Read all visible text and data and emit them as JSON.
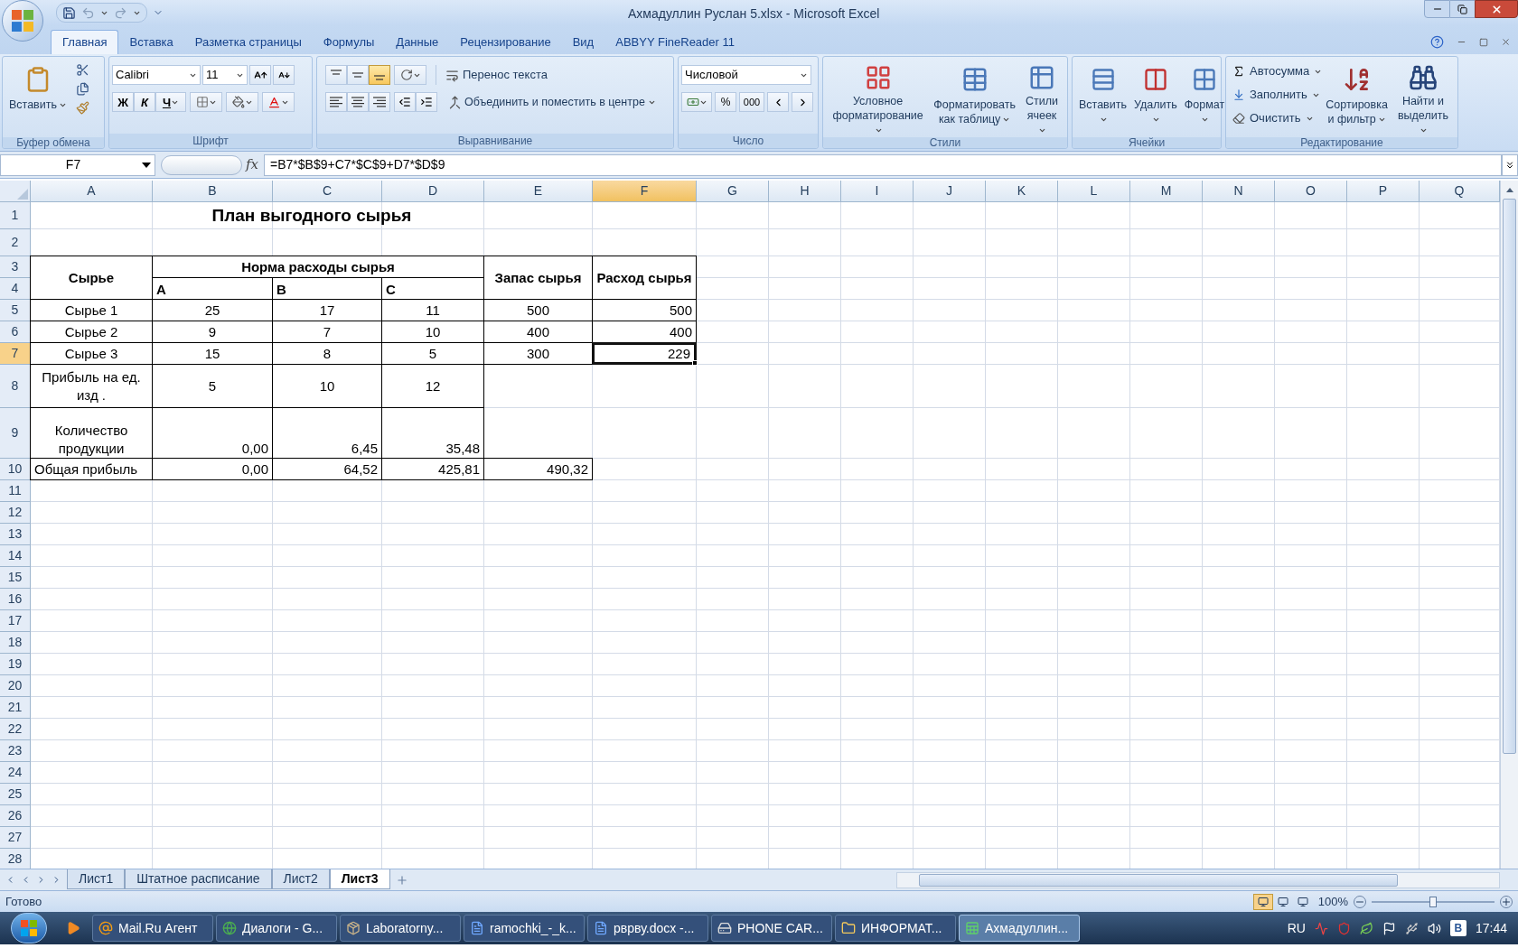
{
  "window": {
    "title": "Ахмадуллин Руслан 5.xlsx - Microsoft Excel"
  },
  "ribbon_tabs": [
    {
      "label": "Главная",
      "selected": true
    },
    {
      "label": "Вставка",
      "selected": false
    },
    {
      "label": "Разметка страницы",
      "selected": false
    },
    {
      "label": "Формулы",
      "selected": false
    },
    {
      "label": "Данные",
      "selected": false
    },
    {
      "label": "Рецензирование",
      "selected": false
    },
    {
      "label": "Вид",
      "selected": false
    },
    {
      "label": "ABBYY FineReader 11",
      "selected": false
    }
  ],
  "ribbon": {
    "clipboard": {
      "paste": "Вставить",
      "label": "Буфер обмена"
    },
    "font": {
      "name": "Calibri",
      "size": "11",
      "bold": "Ж",
      "italic": "К",
      "underline": "Ч",
      "label": "Шрифт"
    },
    "alignment": {
      "vertical": [
        {
          "selected": false
        },
        {
          "selected": false
        },
        {
          "selected": true
        }
      ],
      "wrap": "Перенос текста",
      "merge": "Объединить и поместить в центре",
      "label": "Выравнивание"
    },
    "number": {
      "format": "Числовой",
      "percent": "%",
      "thousands": "000",
      "label": "Число"
    },
    "styles": {
      "buttons": [
        "Условное\nформатирование",
        "Форматировать\nкак таблицу",
        "Стили\nячеек"
      ],
      "label": "Стили"
    },
    "cells": {
      "buttons": [
        "Вставить",
        "Удалить",
        "Формат"
      ],
      "label": "Ячейки"
    },
    "editing": {
      "small": [
        "Автосумма",
        "Заполнить",
        "Очистить"
      ],
      "buttons": [
        "Сортировка\nи фильтр",
        "Найти и\nвыделить"
      ],
      "label": "Редактирование"
    }
  },
  "formula_bar": {
    "name_box": "F7",
    "fx": "fx",
    "formula": "=B7*$B$9+C7*$C$9+D7*$D$9"
  },
  "sheet": {
    "columns": [
      {
        "label": "A",
        "selected": false
      },
      {
        "label": "B",
        "selected": false
      },
      {
        "label": "C",
        "selected": false
      },
      {
        "label": "D",
        "selected": false
      },
      {
        "label": "E",
        "selected": false
      },
      {
        "label": "F",
        "selected": true
      },
      {
        "label": "G",
        "selected": false
      },
      {
        "label": "H",
        "selected": false
      },
      {
        "label": "I",
        "selected": false
      },
      {
        "label": "J",
        "selected": false
      },
      {
        "label": "K",
        "selected": false
      },
      {
        "label": "L",
        "selected": false
      },
      {
        "label": "M",
        "selected": false
      },
      {
        "label": "N",
        "selected": false
      },
      {
        "label": "O",
        "selected": false
      },
      {
        "label": "P",
        "selected": false
      },
      {
        "label": "Q",
        "selected": false
      }
    ],
    "rows": [
      {
        "label": "1",
        "selected": false
      },
      {
        "label": "2",
        "selected": false
      },
      {
        "label": "3",
        "selected": false
      },
      {
        "label": "4",
        "selected": false
      },
      {
        "label": "5",
        "selected": false
      },
      {
        "label": "6",
        "selected": false
      },
      {
        "label": "7",
        "selected": true
      },
      {
        "label": "8",
        "selected": false
      },
      {
        "label": "9",
        "selected": false
      },
      {
        "label": "10",
        "selected": false
      },
      {
        "label": "11",
        "selected": false
      },
      {
        "label": "12",
        "selected": false
      },
      {
        "label": "13",
        "selected": false
      },
      {
        "label": "14",
        "selected": false
      },
      {
        "label": "15",
        "selected": false
      },
      {
        "label": "16",
        "selected": false
      },
      {
        "label": "17",
        "selected": false
      },
      {
        "label": "18",
        "selected": false
      },
      {
        "label": "19",
        "selected": false
      },
      {
        "label": "20",
        "selected": false
      },
      {
        "label": "21",
        "selected": false
      },
      {
        "label": "22",
        "selected": false
      },
      {
        "label": "23",
        "selected": false
      },
      {
        "label": "24",
        "selected": false
      },
      {
        "label": "25",
        "selected": false
      },
      {
        "label": "26",
        "selected": false
      },
      {
        "label": "27",
        "selected": false
      },
      {
        "label": "28",
        "selected": false
      }
    ],
    "title": "План выгодного сырья",
    "header": {
      "col_1": "Сырье",
      "group": "Норма расходы сырья",
      "sub": [
        "A",
        "B",
        "C"
      ],
      "col_5": "Запас сырья",
      "col_6": "Расход сырья"
    },
    "body": [
      {
        "kind": "data",
        "cells": [
          {
            "text": "Сырье 1",
            "selected": false
          },
          {
            "text": "25",
            "selected": false
          },
          {
            "text": "17",
            "selected": false
          },
          {
            "text": "11",
            "selected": false
          },
          {
            "text": "500",
            "selected": false
          },
          {
            "text": "500",
            "selected": false
          }
        ]
      },
      {
        "kind": "data",
        "cells": [
          {
            "text": "Сырье 2",
            "selected": false
          },
          {
            "text": "9",
            "selected": false
          },
          {
            "text": "7",
            "selected": false
          },
          {
            "text": "10",
            "selected": false
          },
          {
            "text": "400",
            "selected": false
          },
          {
            "text": "400",
            "selected": false
          }
        ]
      },
      {
        "kind": "data",
        "cells": [
          {
            "text": "Сырье 3",
            "selected": false
          },
          {
            "text": "15",
            "selected": false
          },
          {
            "text": "8",
            "selected": false
          },
          {
            "text": "5",
            "selected": false
          },
          {
            "text": "300",
            "selected": false
          },
          {
            "text": "229",
            "selected": true
          }
        ]
      },
      {
        "kind": "profit",
        "cells": [
          {
            "text": "Прибыль на ед.\nизд .",
            "selected": false
          },
          {
            "text": "5",
            "selected": false
          },
          {
            "text": "10",
            "selected": false
          },
          {
            "text": "12",
            "selected": false
          }
        ]
      },
      {
        "kind": "quantity",
        "cells": [
          {
            "text": "Количество\nпродукции",
            "selected": false
          },
          {
            "text": "0,00",
            "selected": false
          },
          {
            "text": "6,45",
            "selected": false
          },
          {
            "text": "35,48",
            "selected": false
          }
        ]
      },
      {
        "kind": "total",
        "cells": [
          {
            "text": "Общая прибыль",
            "selected": false
          },
          {
            "text": "0,00",
            "selected": false
          },
          {
            "text": "64,52",
            "selected": false
          },
          {
            "text": "425,81",
            "selected": false
          },
          {
            "text": "490,32",
            "selected": false
          }
        ]
      }
    ]
  },
  "sheet_tabs": [
    {
      "label": "Лист1",
      "selected": false
    },
    {
      "label": "Штатное расписание",
      "selected": false
    },
    {
      "label": "Лист2",
      "selected": false
    },
    {
      "label": "Лист3",
      "selected": true
    }
  ],
  "status_bar": {
    "text": "Готово",
    "views": [
      {
        "selected": true
      },
      {
        "selected": false
      },
      {
        "selected": false
      }
    ],
    "zoom": "100%",
    "zoom_slider": {
      "level": 0.5
    }
  },
  "taskbar": {
    "items": [
      {
        "kind": "mail",
        "label": "Mail.Ru Агент",
        "selected": false
      },
      {
        "kind": "browser",
        "label": "Диалоги - G...",
        "selected": false
      },
      {
        "kind": "archive",
        "label": "Laboratorny...",
        "selected": false
      },
      {
        "kind": "document",
        "label": "ramochki_-_k...",
        "selected": false
      },
      {
        "kind": "document",
        "label": "рврву.docx -...",
        "selected": false
      },
      {
        "kind": "drive",
        "label": "PHONE CAR...",
        "selected": false
      },
      {
        "kind": "folder",
        "label": "ИНФОРМАТ...",
        "selected": false
      },
      {
        "kind": "spreadsheet",
        "label": "Ахмадуллин...",
        "selected": true
      }
    ],
    "language": "RU",
    "tray_badge": "В",
    "time": "17:44"
  }
}
